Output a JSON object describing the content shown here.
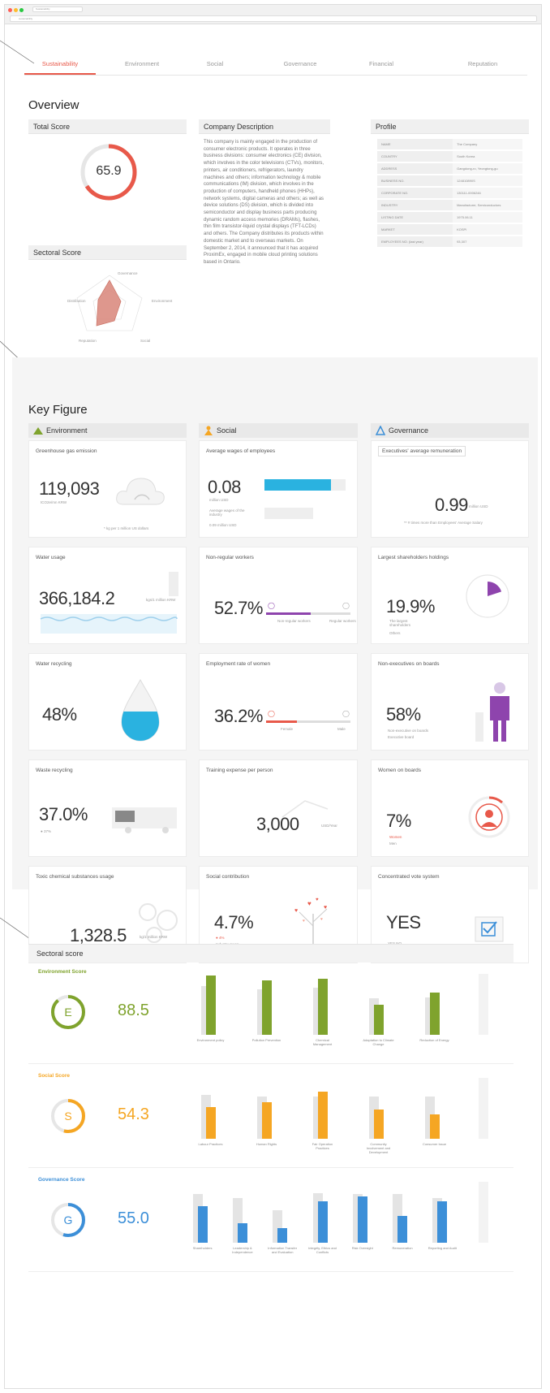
{
  "browser": {
    "tab": "Sustainability",
    "url": "sustainability"
  },
  "tabs": [
    "Sustainability",
    "Environment",
    "Social",
    "Governance",
    "Financial",
    "Reputation"
  ],
  "overview": {
    "title": "Overview",
    "total_score_title": "Total Score",
    "total_score": "65.9",
    "total_score_fraction": 0.659,
    "sectoral_title": "Sectoral Score",
    "radar_labels": [
      "Governance",
      "Environment",
      "Social",
      "Reputation",
      "Distribution"
    ],
    "company_title": "Company Description",
    "company_text": "This company is mainly engaged in the production of consumer electronic products. It operates in three business divisions: consumer electronics (CE) division, which involves in the color televisions (CTVs), monitors, printers, air conditioners, refrigerators, laundry machines and others; information technology & mobile communications (IM) division, which involves in the production of computers, handheld phones (HHPs), network systems, digital cameras and others; as well as device solutions (DS) division, which is divided into semiconductor and display business parts producing dynamic random access memories (DRAMs), flashes, thin film transistor-liquid crystal displays (TFT-LCDs) and others. The Company distributes its products within domestic market and to overseas markets. On September 2, 2014, it announced that it has acquired ProximEx, engaged in mobile cloud printing solutions based in Ontario.",
    "profile_title": "Profile",
    "profile_rows": [
      [
        "NAME",
        "The Company"
      ],
      [
        "COUNTRY",
        "South Korea"
      ],
      [
        "ADDRESS",
        "Gangdong-ro, Yeongtong-gu"
      ],
      [
        "BUSINESS NO.",
        "124810890S"
      ],
      [
        "CORPORATE NO.",
        "130111-0006246"
      ],
      [
        "INDUSTRY",
        "Manufacturer, Semiconductors"
      ],
      [
        "LISTING DATE",
        "1975.06.11"
      ],
      [
        "MARKET",
        "KOSPI"
      ],
      [
        "EMPLOYEES NO. (last year)",
        "93,307"
      ]
    ]
  },
  "key_figure": {
    "title": "Key Figure",
    "columns": [
      "Environment",
      "Social",
      "Governance"
    ],
    "env": {
      "ghg_title": "Greenhouse gas emission",
      "ghg_value": "119,093",
      "ghg_unit": "tCO2e/mn KRW",
      "ghg_note": "* kg per 1 million US dollars",
      "water_title": "Water usage",
      "water_value": "366,184.2",
      "water_unit": "kgs/1 million KRW",
      "recycle_title": "Water recycling",
      "recycle_value": "48%",
      "recycle_fraction": 0.48,
      "waste_title": "Waste recycling",
      "waste_value": "37.0%",
      "waste_legend": "● 37%",
      "toxic_title": "Toxic chemical substances usage",
      "toxic_value": "1,328.5",
      "toxic_unit": "kg/1 million KRW"
    },
    "soc": {
      "wage_title": "Average wages of employees",
      "wage_value": "0.08",
      "wage_unit": "million USD",
      "wage_sub1": "Average wages of the industry",
      "wage_sub2": "0.09 million USD",
      "nonreg_title": "Non-regular workers",
      "nonreg_value": "52.7%",
      "nonreg_fraction": 0.527,
      "nonreg_left": "Non-regular workers",
      "nonreg_right": "Regular workers",
      "women_title": "Employment rate of women",
      "women_value": "36.2%",
      "women_fraction": 0.362,
      "women_left": "Female",
      "women_right": "Male",
      "training_title": "Training expense per person",
      "training_value": "3,000",
      "training_unit": "USD/Year",
      "social_title": "Social contribution",
      "social_value": "4.7%",
      "social_legend1": "● 4%",
      "social_legend2": "Industry mean"
    },
    "gov": {
      "exec_title": "Executives' average remuneration",
      "exec_value": "0.99",
      "exec_unit": "million USD",
      "exec_note": "** # times more than Employees' Average Salary",
      "holders_title": "Largest shareholders holdings",
      "holders_value": "19.9%",
      "holders_fraction": 0.199,
      "holders_legend1": "The largest shareholders",
      "holders_legend2": "Others",
      "nonexec_title": "Non-executives on boards",
      "nonexec_value": "58%",
      "nonexec_legend1": "Non-executive on boards",
      "nonexec_legend2": "Executive board",
      "womenb_title": "Women on boards",
      "womenb_value": "7%",
      "womenb_legend1": "Women",
      "womenb_legend2": "Men",
      "vote_title": "Concentrated vote system",
      "vote_value": "YES",
      "vote_legend": "YES   NO"
    }
  },
  "sectoral": {
    "title": "Sectoral score",
    "bands": [
      {
        "label": "Environment Score",
        "letter": "E",
        "score": "88.5",
        "color": "#7fa32d",
        "cats": [
          "Environment policy",
          "Pollution Prevention",
          "Chemical Management",
          "Adaptation to Climate Change",
          "Reduction of Energy"
        ],
        "values": [
          98,
          90,
          92,
          50,
          70
        ],
        "bench": [
          80,
          75,
          78,
          60,
          62
        ]
      },
      {
        "label": "Social Score",
        "letter": "S",
        "score": "54.3",
        "color": "#f5a623",
        "cats": [
          "Labour Practices",
          "Human Rights",
          "Fair Operation Practices",
          "Community Involvement and Development",
          "Consumer Issue"
        ],
        "values": [
          52,
          60,
          78,
          48,
          40
        ],
        "bench": [
          72,
          70,
          70,
          70,
          70
        ]
      },
      {
        "label": "Governance Score",
        "letter": "G",
        "score": "55.0",
        "color": "#3c8fd8",
        "cats": [
          "Shareholders",
          "Leadership & Independence",
          "Information Transfer and Evaluation",
          "Integrity, Ethics and Conflicts",
          "Risk Oversight",
          "Remuneration",
          "Reporting and Audit"
        ],
        "values": [
          60,
          32,
          24,
          68,
          76,
          44,
          68
        ],
        "bench": [
          80,
          74,
          54,
          82,
          80,
          80,
          74
        ]
      }
    ]
  },
  "colors": {
    "accent": "#e8594a",
    "env": "#7fa32d",
    "soc": "#f5a623",
    "gov": "#3c8fd8",
    "purple": "#8e44ad"
  }
}
